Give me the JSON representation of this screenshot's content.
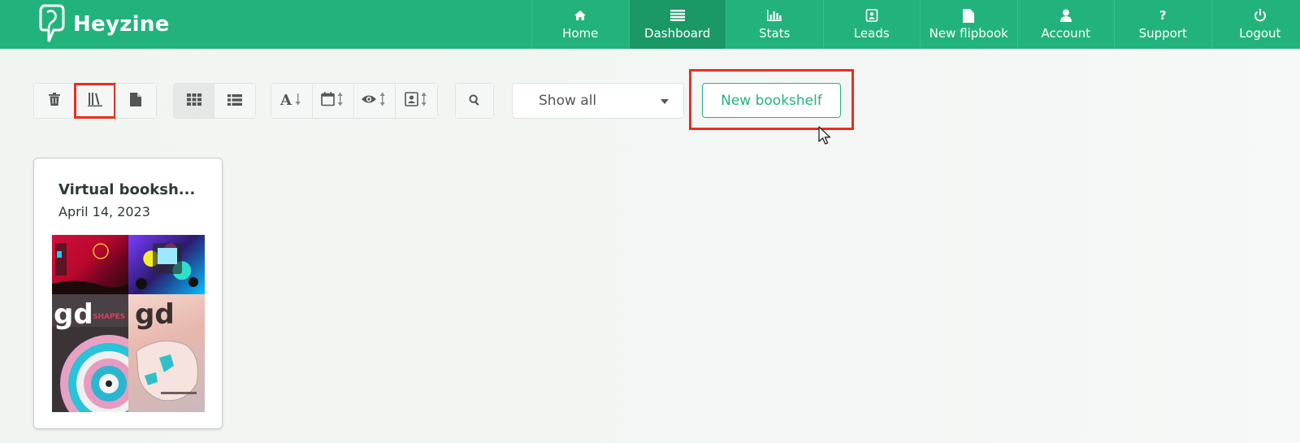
{
  "brand": {
    "name": "Heyzine"
  },
  "nav": {
    "items": [
      {
        "label": "Home",
        "icon": "home-icon"
      },
      {
        "label": "Dashboard",
        "icon": "list-icon",
        "active": true
      },
      {
        "label": "Stats",
        "icon": "bar-chart-icon"
      },
      {
        "label": "Leads",
        "icon": "contact-card-icon"
      },
      {
        "label": "New flipbook",
        "icon": "document-icon"
      },
      {
        "label": "Account",
        "icon": "user-icon"
      },
      {
        "label": "Support",
        "icon": "question-icon"
      },
      {
        "label": "Logout",
        "icon": "power-icon"
      }
    ]
  },
  "toolbar": {
    "view_buttons": [
      "trash-icon",
      "bookshelf-icon",
      "document-icon"
    ],
    "layout_buttons": [
      "grid-icon",
      "list-icon"
    ],
    "sort_buttons": [
      "sort-alpha-icon",
      "sort-date-icon",
      "sort-views-icon",
      "sort-leads-icon"
    ],
    "search_icon": "search-icon",
    "filter": {
      "selected": "Show all"
    },
    "new_bookshelf_label": "New bookshelf"
  },
  "cards": [
    {
      "title": "Virtual booksh...",
      "date": "April 14, 2023"
    }
  ],
  "colors": {
    "brand_green": "#22b37c",
    "active_nav": "#1a9866",
    "highlight_red": "#e6301f"
  }
}
